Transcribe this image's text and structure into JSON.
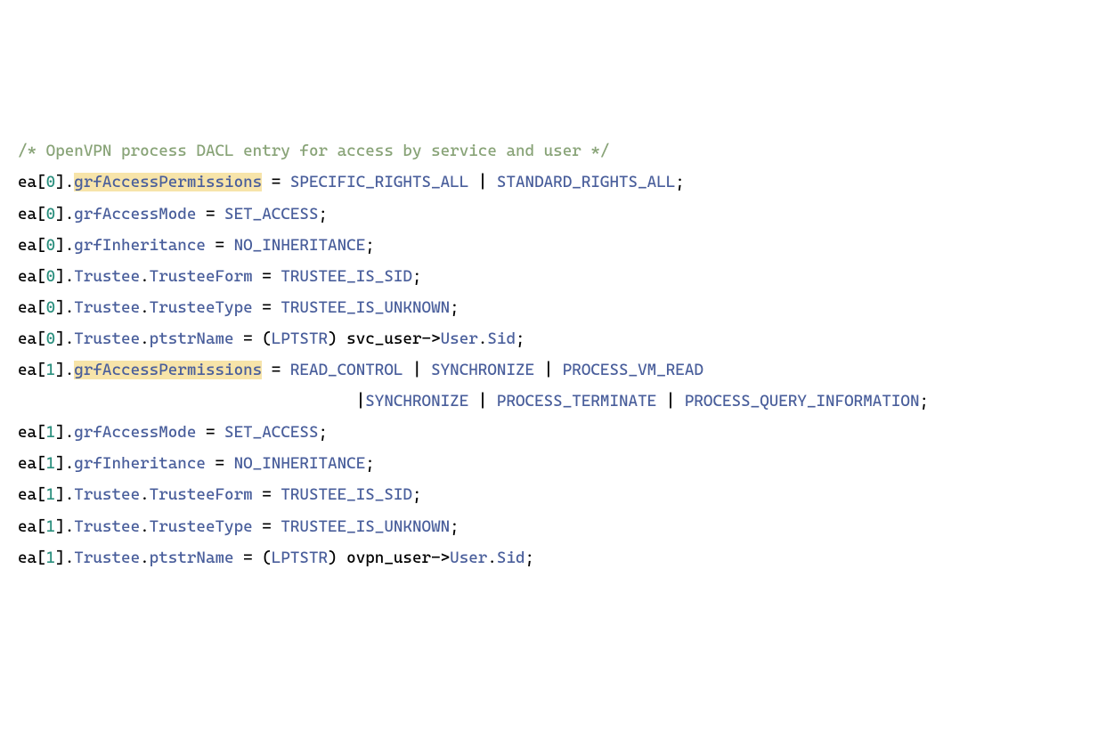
{
  "lines": {
    "l1": {
      "a": "/* OpenVPN process DACL entry for access by service and user */"
    },
    "l2": {
      "a": "ea",
      "b": "[",
      "c": "0",
      "d": "].",
      "e": "grfAccessPermissions",
      "f": " = ",
      "g": "SPECIFIC_RIGHTS_ALL",
      "h": " | ",
      "i": "STANDARD_RIGHTS_ALL",
      "j": ";"
    },
    "l3": {
      "a": "ea",
      "b": "[",
      "c": "0",
      "d": "].",
      "e": "grfAccessMode",
      "f": " = ",
      "g": "SET_ACCESS",
      "h": ";"
    },
    "l4": {
      "a": "ea",
      "b": "[",
      "c": "0",
      "d": "].",
      "e": "grfInheritance",
      "f": " = ",
      "g": "NO_INHERITANCE",
      "h": ";"
    },
    "l5": {
      "a": "ea",
      "b": "[",
      "c": "0",
      "d": "].",
      "e": "Trustee",
      "f": ".",
      "g": "TrusteeForm",
      "h": " = ",
      "i": "TRUSTEE_IS_SID",
      "j": ";"
    },
    "l6": {
      "a": "ea",
      "b": "[",
      "c": "0",
      "d": "].",
      "e": "Trustee",
      "f": ".",
      "g": "TrusteeType",
      "h": " = ",
      "i": "TRUSTEE_IS_UNKNOWN",
      "j": ";"
    },
    "l7": {
      "a": "ea",
      "b": "[",
      "c": "0",
      "d": "].",
      "e": "Trustee",
      "f": ".",
      "g": "ptstrName",
      "h": " = (",
      "i": "LPTSTR",
      "j": ") svc_user->",
      "k": "User",
      "l": ".",
      "m": "Sid",
      "n": ";"
    },
    "l8": {
      "a": "ea",
      "b": "[",
      "c": "1",
      "d": "].",
      "e": "grfAccessPermissions",
      "f": " = ",
      "g": "READ_CONTROL",
      "h": " | ",
      "i": "SYNCHRONIZE",
      "j": " | ",
      "k": "PROCESS_VM_READ"
    },
    "l9": {
      "a": "                                    |",
      "b": "SYNCHRONIZE",
      "c": " | ",
      "d": "PROCESS_TERMINATE",
      "e": " | ",
      "f": "PROCESS_QUERY_INFORMATION",
      "g": ";"
    },
    "l10": {
      "a": "ea",
      "b": "[",
      "c": "1",
      "d": "].",
      "e": "grfAccessMode",
      "f": " = ",
      "g": "SET_ACCESS",
      "h": ";"
    },
    "l11": {
      "a": "ea",
      "b": "[",
      "c": "1",
      "d": "].",
      "e": "grfInheritance",
      "f": " = ",
      "g": "NO_INHERITANCE",
      "h": ";"
    },
    "l12": {
      "a": "ea",
      "b": "[",
      "c": "1",
      "d": "].",
      "e": "Trustee",
      "f": ".",
      "g": "TrusteeForm",
      "h": " = ",
      "i": "TRUSTEE_IS_SID",
      "j": ";"
    },
    "l13": {
      "a": "ea",
      "b": "[",
      "c": "1",
      "d": "].",
      "e": "Trustee",
      "f": ".",
      "g": "TrusteeType",
      "h": " = ",
      "i": "TRUSTEE_IS_UNKNOWN",
      "j": ";"
    },
    "l14": {
      "a": "ea",
      "b": "[",
      "c": "1",
      "d": "].",
      "e": "Trustee",
      "f": ".",
      "g": "ptstrName",
      "h": " = (",
      "i": "LPTSTR",
      "j": ") ovpn_user->",
      "k": "User",
      "l": ".",
      "m": "Sid",
      "n": ";"
    }
  }
}
